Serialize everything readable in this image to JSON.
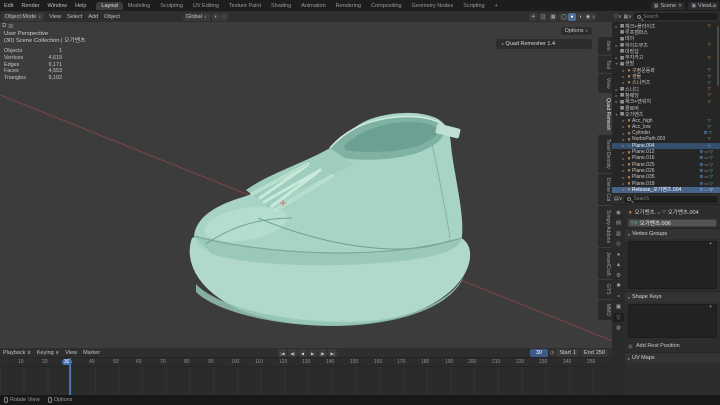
{
  "topbar": {
    "menus": [
      {
        "label": "Edit"
      },
      {
        "label": "Render"
      },
      {
        "label": "Window"
      },
      {
        "label": "Help"
      }
    ],
    "workspaces": [
      {
        "label": "Layout",
        "cls": "active"
      },
      {
        "label": "Modeling",
        "cls": ""
      },
      {
        "label": "Sculpting",
        "cls": ""
      },
      {
        "label": "UV Editing",
        "cls": ""
      },
      {
        "label": "Texture Paint",
        "cls": ""
      },
      {
        "label": "Shading",
        "cls": ""
      },
      {
        "label": "Animation",
        "cls": ""
      },
      {
        "label": "Rendering",
        "cls": ""
      },
      {
        "label": "Compositing",
        "cls": ""
      },
      {
        "label": "Geometry Nodes",
        "cls": ""
      },
      {
        "label": "Scripting",
        "cls": ""
      },
      {
        "label": "+",
        "cls": ""
      }
    ],
    "scene_label": "Scene",
    "view_layer_label": "ViewLa"
  },
  "viewport_header": {
    "mode": "Object Mode",
    "menus": [
      {
        "label": "View"
      },
      {
        "label": "Select"
      },
      {
        "label": "Add"
      },
      {
        "label": "Object"
      }
    ],
    "orientation": "Global",
    "options_label": "Options"
  },
  "viewport": {
    "perspective_label": "User Perspective",
    "collection_label": "(30) Scene Collection | 오가벤츠",
    "stats": [
      {
        "label": "Objects",
        "value": "1"
      },
      {
        "label": "Vertices",
        "value": "4,619"
      },
      {
        "label": "Edges",
        "value": "9,171"
      },
      {
        "label": "Faces",
        "value": "4,553"
      },
      {
        "label": "Triangles",
        "value": "9,102"
      }
    ],
    "quad_remesher_label": "Quad Remesher 1.4",
    "side_tabs": [
      {
        "label": "Item",
        "cls": ""
      },
      {
        "label": "Tool",
        "cls": ""
      },
      {
        "label": "View",
        "cls": ""
      },
      {
        "label": "Quad Remesh",
        "cls": "active"
      },
      {
        "label": "Texel Density",
        "cls": ""
      },
      {
        "label": "Divine Cut",
        "cls": ""
      },
      {
        "label": "Simply Addons",
        "cls": ""
      },
      {
        "label": "JewelCraft",
        "cls": ""
      },
      {
        "label": "GYS",
        "cls": ""
      },
      {
        "label": "MMD",
        "cls": ""
      }
    ],
    "colors": {
      "shoe_body": "#a7d4c6",
      "shoe_sole": "#b0d9ca",
      "axis_red": "#b34b4b",
      "background": "#3c3c3c"
    }
  },
  "outliner": {
    "search_placeholder": "Search",
    "items": [
      {
        "pad": "padding-left:2px",
        "arrow": "▸",
        "icon": "▦",
        "iconc": "col",
        "label": "체크+플라이츠",
        "cls": "",
        "b1": "▽",
        "b1c": "bor",
        "b2": "",
        "b2c": "",
        "b3": "",
        "b3c": ""
      },
      {
        "pad": "padding-left:2px",
        "arrow": "",
        "icon": "▦",
        "iconc": "col",
        "label": "루프캠퍼스",
        "cls": "",
        "b1": "",
        "b1c": "",
        "b2": "",
        "b2c": "",
        "b3": "",
        "b3c": ""
      },
      {
        "pad": "padding-left:2px",
        "arrow": "",
        "icon": "▦",
        "iconc": "col",
        "label": "데이",
        "cls": "",
        "b1": "",
        "b1c": "",
        "b2": "",
        "b2c": "",
        "b3": "",
        "b3c": ""
      },
      {
        "pad": "padding-left:2px",
        "arrow": "▸",
        "icon": "▦",
        "iconc": "col",
        "label": "하이드부츠",
        "cls": "",
        "b1": "▽",
        "b1c": "bor",
        "b2": "",
        "b2c": "",
        "b3": "",
        "b3c": ""
      },
      {
        "pad": "padding-left:2px",
        "arrow": "",
        "icon": "▦",
        "iconc": "col",
        "label": "마장샵",
        "cls": "",
        "b1": "",
        "b1c": "",
        "b2": "",
        "b2c": "",
        "b3": "",
        "b3c": ""
      },
      {
        "pad": "padding-left:2px",
        "arrow": "▸",
        "icon": "▦",
        "iconc": "col",
        "label": "무지카고",
        "cls": "",
        "b1": "▽",
        "b1c": "bor",
        "b2": "",
        "b2c": "",
        "b3": "",
        "b3c": ""
      },
      {
        "pad": "padding-left:2px",
        "arrow": "▾",
        "icon": "▦",
        "iconc": "col",
        "label": "샌발",
        "cls": "",
        "b1": "",
        "b1c": "",
        "b2": "",
        "b2c": "",
        "b3": "",
        "b3c": ""
      },
      {
        "pad": "padding-left:9px",
        "arrow": "▸",
        "icon": "▼",
        "iconc": "obj",
        "label": "구정운동화",
        "cls": "",
        "b1": "▽",
        "b1c": "grn",
        "b2": "",
        "b2c": "",
        "b3": "",
        "b3c": ""
      },
      {
        "pad": "padding-left:9px",
        "arrow": "▸",
        "icon": "▼",
        "iconc": "obj",
        "label": "샌들",
        "cls": "",
        "b1": "▽",
        "b1c": "grn",
        "b2": "",
        "b2c": "",
        "b3": "",
        "b3c": ""
      },
      {
        "pad": "padding-left:9px",
        "arrow": "▸",
        "icon": "▼",
        "iconc": "obj",
        "label": "스니커즈",
        "cls": "",
        "b1": "▽",
        "b1c": "grn",
        "b2": "",
        "b2c": "",
        "b3": "",
        "b3c": ""
      },
      {
        "pad": "padding-left:2px",
        "arrow": "▸",
        "icon": "▦",
        "iconc": "col",
        "label": "스니디",
        "cls": "",
        "b1": "▽",
        "b1c": "bor",
        "b2": "",
        "b2c": "",
        "b3": "",
        "b3c": ""
      },
      {
        "pad": "padding-left:2px",
        "arrow": "▸",
        "icon": "▦",
        "iconc": "col",
        "label": "참웨딩",
        "cls": "",
        "b1": "▽",
        "b1c": "bor",
        "b2": "",
        "b2c": "",
        "b3": "",
        "b3c": ""
      },
      {
        "pad": "padding-left:2px",
        "arrow": "▸",
        "icon": "▦",
        "iconc": "col",
        "label": "체크+엔워지",
        "cls": "",
        "b1": "▽",
        "b1c": "bor",
        "b2": "",
        "b2c": "",
        "b3": "",
        "b3c": ""
      },
      {
        "pad": "padding-left:2px",
        "arrow": "",
        "icon": "▦",
        "iconc": "col",
        "label": "클로버",
        "cls": "",
        "b1": "",
        "b1c": "",
        "b2": "",
        "b2c": "",
        "b3": "",
        "b3c": ""
      },
      {
        "pad": "padding-left:2px",
        "arrow": "▾",
        "icon": "▦",
        "iconc": "col",
        "label": "오가벤츠",
        "cls": "",
        "b1": "",
        "b1c": "",
        "b2": "",
        "b2c": "",
        "b3": "",
        "b3c": ""
      },
      {
        "pad": "padding-left:9px",
        "arrow": "▸",
        "icon": "▼",
        "iconc": "obj",
        "label": "Acc_high",
        "cls": "",
        "b1": "▽",
        "b1c": "grn",
        "b2": "",
        "b2c": "",
        "b3": "",
        "b3c": ""
      },
      {
        "pad": "padding-left:9px",
        "arrow": "▸",
        "icon": "▼",
        "iconc": "obj",
        "label": "Acc_low",
        "cls": "",
        "b1": "▽",
        "b1c": "grn",
        "b2": "",
        "b2c": "",
        "b3": "",
        "b3c": ""
      },
      {
        "pad": "padding-left:9px",
        "arrow": "▸",
        "icon": "▼",
        "iconc": "obj",
        "label": "Cylinder",
        "cls": "",
        "b1": "⚙",
        "b1c": "blu",
        "b2": "▽",
        "b2c": "grn",
        "b3": "",
        "b3c": ""
      },
      {
        "pad": "padding-left:9px",
        "arrow": "▸",
        "icon": "▼",
        "iconc": "obj",
        "label": "NurbsPath.003",
        "cls": "",
        "b1": "▽",
        "b1c": "grn",
        "b2": "",
        "b2c": "",
        "b3": "",
        "b3c": ""
      },
      {
        "pad": "padding-left:9px",
        "arrow": "▸",
        "icon": "∿",
        "iconc": "blu",
        "label": "Plane.004",
        "cls": "sel",
        "b1": "∿",
        "b1c": "blu",
        "b2": "",
        "b2c": "",
        "b3": "",
        "b3c": ""
      },
      {
        "pad": "padding-left:9px",
        "arrow": "▸",
        "icon": "▼",
        "iconc": "obj",
        "label": "Plane.012",
        "cls": "",
        "b1": "⚙",
        "b1c": "blu",
        "b2": "▭",
        "b2c": "gry",
        "b3": "▽",
        "b3c": "grn"
      },
      {
        "pad": "padding-left:9px",
        "arrow": "▸",
        "icon": "▼",
        "iconc": "obj",
        "label": "Plane.016",
        "cls": "",
        "b1": "⚙",
        "b1c": "blu",
        "b2": "▭",
        "b2c": "gry",
        "b3": "▽",
        "b3c": "grn"
      },
      {
        "pad": "padding-left:9px",
        "arrow": "▸",
        "icon": "▼",
        "iconc": "obj",
        "label": "Plane.025",
        "cls": "",
        "b1": "⚙",
        "b1c": "blu",
        "b2": "▭",
        "b2c": "gry",
        "b3": "▽",
        "b3c": "grn"
      },
      {
        "pad": "padding-left:9px",
        "arrow": "▸",
        "icon": "▼",
        "iconc": "obj",
        "label": "Plane.026",
        "cls": "",
        "b1": "⚙",
        "b1c": "blu",
        "b2": "▭",
        "b2c": "gry",
        "b3": "▽",
        "b3c": "grn"
      },
      {
        "pad": "padding-left:9px",
        "arrow": "▸",
        "icon": "▼",
        "iconc": "obj",
        "label": "Plane.035",
        "cls": "",
        "b1": "⚙",
        "b1c": "blu",
        "b2": "▭",
        "b2c": "gry",
        "b3": "▽",
        "b3c": "grn"
      },
      {
        "pad": "padding-left:9px",
        "arrow": "▸",
        "icon": "▼",
        "iconc": "obj",
        "label": "Plane.018",
        "cls": "",
        "b1": "⚙",
        "b1c": "blu",
        "b2": "▭",
        "b2c": "gry",
        "b3": "▽",
        "b3c": "grn"
      },
      {
        "pad": "padding-left:9px",
        "arrow": "▸",
        "icon": "▼",
        "iconc": "obj",
        "label": "Release_오가벤츠.004",
        "cls": "act",
        "b1": "⚙",
        "b1c": "blu",
        "b2": "▭",
        "b2c": "gry",
        "b3": "▽",
        "b3c": "wht"
      }
    ]
  },
  "properties": {
    "search_placeholder": "Search",
    "breadcrumb_object": "오가벤츠.",
    "breadcrumb_sep": "▸",
    "breadcrumb_data": "오가벤츠.004",
    "data_name_value": "오가벤츠.006",
    "tabs": [
      {
        "glyph": "◉",
        "cls": ""
      },
      {
        "glyph": "▤",
        "cls": ""
      },
      {
        "glyph": "▥",
        "cls": ""
      },
      {
        "glyph": "◎",
        "cls": ""
      },
      {
        "glyph": "●",
        "cls": ""
      },
      {
        "glyph": "▲",
        "cls": "obj"
      },
      {
        "glyph": "⚙",
        "cls": "blu"
      },
      {
        "glyph": "✱",
        "cls": ""
      },
      {
        "glyph": "≈",
        "cls": ""
      },
      {
        "glyph": "▣",
        "cls": ""
      },
      {
        "glyph": "▽",
        "cls": "grn active"
      },
      {
        "glyph": "◍",
        "cls": "bor"
      }
    ],
    "panels": {
      "vertex_groups": "Vertex Groups",
      "shape_keys": "Shape Keys",
      "add_rest_position": "Add Rest Position",
      "uv_maps": "UV Maps"
    },
    "list_add_button": "+"
  },
  "timeline": {
    "menus": [
      {
        "label": "Playback ∨"
      },
      {
        "label": "Keying ∨"
      },
      {
        "label": "View"
      },
      {
        "label": "Marker"
      }
    ],
    "transport": [
      {
        "glyph": "|◀"
      },
      {
        "glyph": "◀|"
      },
      {
        "glyph": "◀"
      },
      {
        "glyph": "▶"
      },
      {
        "glyph": "|▶"
      },
      {
        "glyph": "▶|"
      }
    ],
    "current_frame": "30",
    "start_label": "Start",
    "start_value": "1",
    "end_label": "End",
    "end_value": "250",
    "ticks": [
      {
        "label": "10",
        "style": "left:18px",
        "cls": ""
      },
      {
        "label": "20",
        "style": "left:42px",
        "cls": ""
      },
      {
        "label": "30",
        "style": "left:65px",
        "cls": "cur"
      },
      {
        "label": "40",
        "style": "left:89px",
        "cls": ""
      },
      {
        "label": "50",
        "style": "left:113px",
        "cls": ""
      },
      {
        "label": "60",
        "style": "left:136px",
        "cls": ""
      },
      {
        "label": "70",
        "style": "left:160px",
        "cls": ""
      },
      {
        "label": "80",
        "style": "left:184px",
        "cls": ""
      },
      {
        "label": "90",
        "style": "left:208px",
        "cls": ""
      },
      {
        "label": "100",
        "style": "left:231px",
        "cls": ""
      },
      {
        "label": "110",
        "style": "left:255px",
        "cls": ""
      },
      {
        "label": "120",
        "style": "left:279px",
        "cls": ""
      },
      {
        "label": "130",
        "style": "left:302px",
        "cls": ""
      },
      {
        "label": "140",
        "style": "left:326px",
        "cls": ""
      },
      {
        "label": "150",
        "style": "left:350px",
        "cls": ""
      },
      {
        "label": "160",
        "style": "left:374px",
        "cls": ""
      },
      {
        "label": "170",
        "style": "left:397px",
        "cls": ""
      },
      {
        "label": "180",
        "style": "left:421px",
        "cls": ""
      },
      {
        "label": "190",
        "style": "left:445px",
        "cls": ""
      },
      {
        "label": "200",
        "style": "left:468px",
        "cls": ""
      },
      {
        "label": "210",
        "style": "left:492px",
        "cls": ""
      },
      {
        "label": "220",
        "style": "left:516px",
        "cls": ""
      },
      {
        "label": "230",
        "style": "left:539px",
        "cls": ""
      },
      {
        "label": "240",
        "style": "left:563px",
        "cls": ""
      },
      {
        "label": "250",
        "style": "left:587px",
        "cls": ""
      }
    ]
  },
  "statusbar": {
    "items": [
      {
        "label": "Rotate View"
      },
      {
        "label": "Options"
      }
    ]
  }
}
